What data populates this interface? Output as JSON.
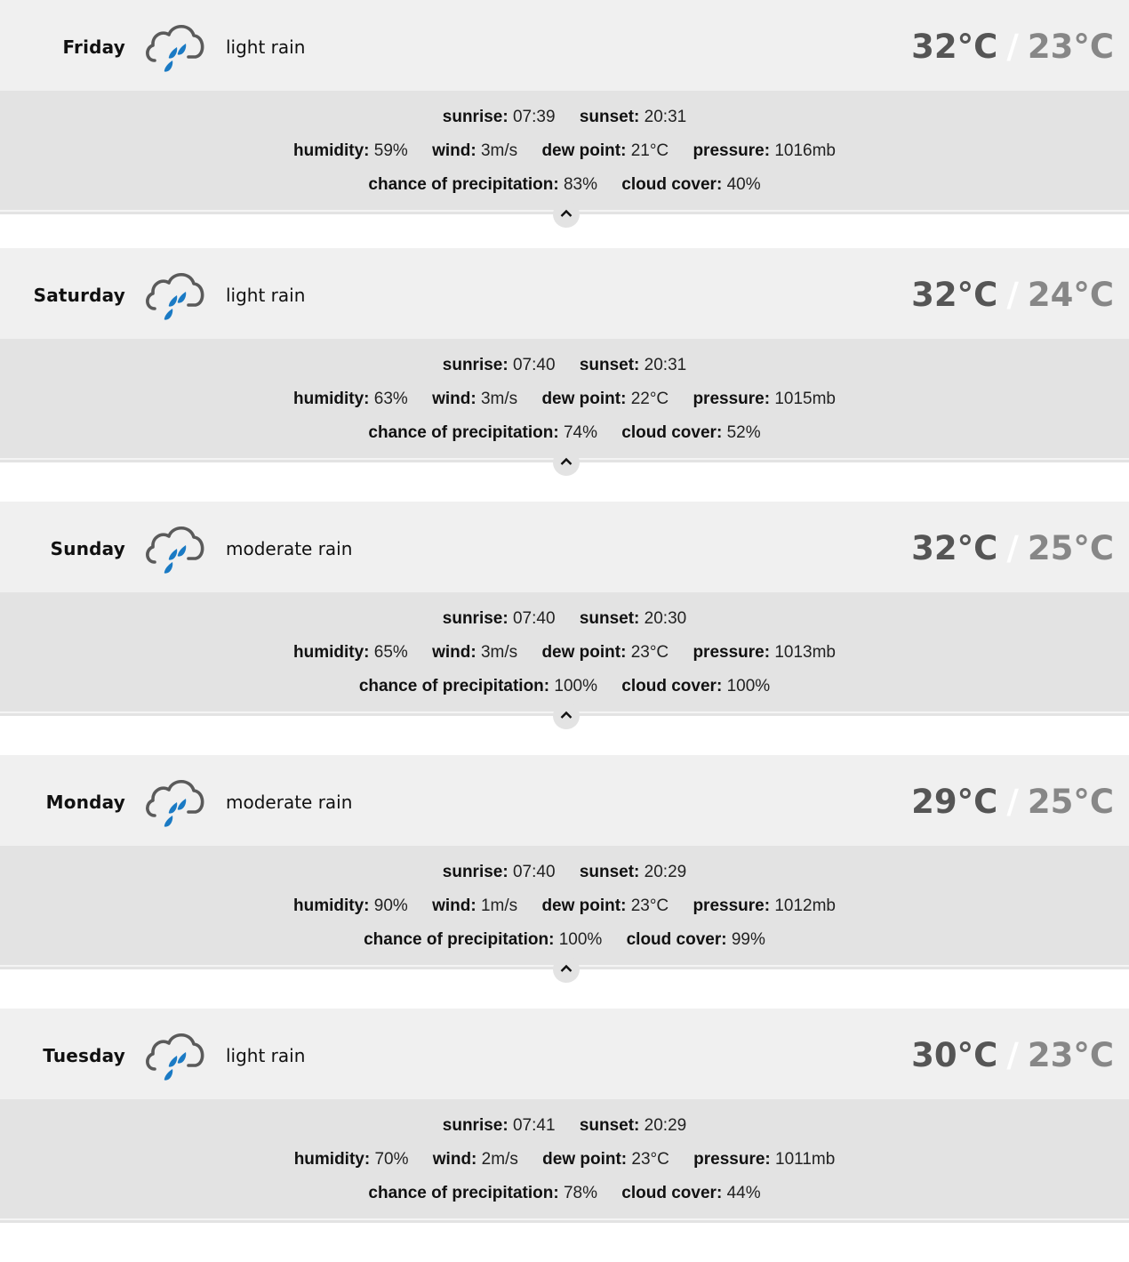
{
  "forecast": [
    {
      "day": "Friday",
      "icon": "light-rain-cloud-icon",
      "description": "light rain",
      "high": "32°C",
      "separator": "/",
      "low": "23°C",
      "details": {
        "sunrise_label": "sunrise:",
        "sunrise": "07:39",
        "sunset_label": "sunset:",
        "sunset": "20:31",
        "humidity_label": "humidity:",
        "humidity": "59%",
        "wind_label": "wind:",
        "wind": "3m/s",
        "dew_point_label": "dew point:",
        "dew_point": "21°C",
        "pressure_label": "pressure:",
        "pressure": "1016mb",
        "precip_label": "chance of precipitation:",
        "precip": "83%",
        "cloud_label": "cloud cover:",
        "cloud": "40%"
      },
      "toggle_icon": "chevron-up-icon"
    },
    {
      "day": "Saturday",
      "icon": "light-rain-cloud-icon",
      "description": "light rain",
      "high": "32°C",
      "separator": "/",
      "low": "24°C",
      "details": {
        "sunrise_label": "sunrise:",
        "sunrise": "07:40",
        "sunset_label": "sunset:",
        "sunset": "20:31",
        "humidity_label": "humidity:",
        "humidity": "63%",
        "wind_label": "wind:",
        "wind": "3m/s",
        "dew_point_label": "dew point:",
        "dew_point": "22°C",
        "pressure_label": "pressure:",
        "pressure": "1015mb",
        "precip_label": "chance of precipitation:",
        "precip": "74%",
        "cloud_label": "cloud cover:",
        "cloud": "52%"
      },
      "toggle_icon": "chevron-up-icon"
    },
    {
      "day": "Sunday",
      "icon": "moderate-rain-cloud-icon",
      "description": "moderate rain",
      "high": "32°C",
      "separator": "/",
      "low": "25°C",
      "details": {
        "sunrise_label": "sunrise:",
        "sunrise": "07:40",
        "sunset_label": "sunset:",
        "sunset": "20:30",
        "humidity_label": "humidity:",
        "humidity": "65%",
        "wind_label": "wind:",
        "wind": "3m/s",
        "dew_point_label": "dew point:",
        "dew_point": "23°C",
        "pressure_label": "pressure:",
        "pressure": "1013mb",
        "precip_label": "chance of precipitation:",
        "precip": "100%",
        "cloud_label": "cloud cover:",
        "cloud": "100%"
      },
      "toggle_icon": "chevron-up-icon"
    },
    {
      "day": "Monday",
      "icon": "moderate-rain-cloud-icon",
      "description": "moderate rain",
      "high": "29°C",
      "separator": "/",
      "low": "25°C",
      "details": {
        "sunrise_label": "sunrise:",
        "sunrise": "07:40",
        "sunset_label": "sunset:",
        "sunset": "20:29",
        "humidity_label": "humidity:",
        "humidity": "90%",
        "wind_label": "wind:",
        "wind": "1m/s",
        "dew_point_label": "dew point:",
        "dew_point": "23°C",
        "pressure_label": "pressure:",
        "pressure": "1012mb",
        "precip_label": "chance of precipitation:",
        "precip": "100%",
        "cloud_label": "cloud cover:",
        "cloud": "99%"
      },
      "toggle_icon": "chevron-up-icon"
    },
    {
      "day": "Tuesday",
      "icon": "light-rain-cloud-icon",
      "description": "light rain",
      "high": "30°C",
      "separator": "/",
      "low": "23°C",
      "details": {
        "sunrise_label": "sunrise:",
        "sunrise": "07:41",
        "sunset_label": "sunset:",
        "sunset": "20:29",
        "humidity_label": "humidity:",
        "humidity": "70%",
        "wind_label": "wind:",
        "wind": "2m/s",
        "dew_point_label": "dew point:",
        "dew_point": "23°C",
        "pressure_label": "pressure:",
        "pressure": "1011mb",
        "precip_label": "chance of precipitation:",
        "precip": "78%",
        "cloud_label": "cloud cover:",
        "cloud": "44%"
      },
      "toggle_icon": null
    }
  ],
  "colors": {
    "header_bg": "#f0f0f0",
    "details_bg": "#e3e3e3",
    "high_temp": "#555555",
    "low_temp": "#878787",
    "cloud_outline": "#5a5a5a",
    "rain_drop": "#1a7ac4"
  }
}
